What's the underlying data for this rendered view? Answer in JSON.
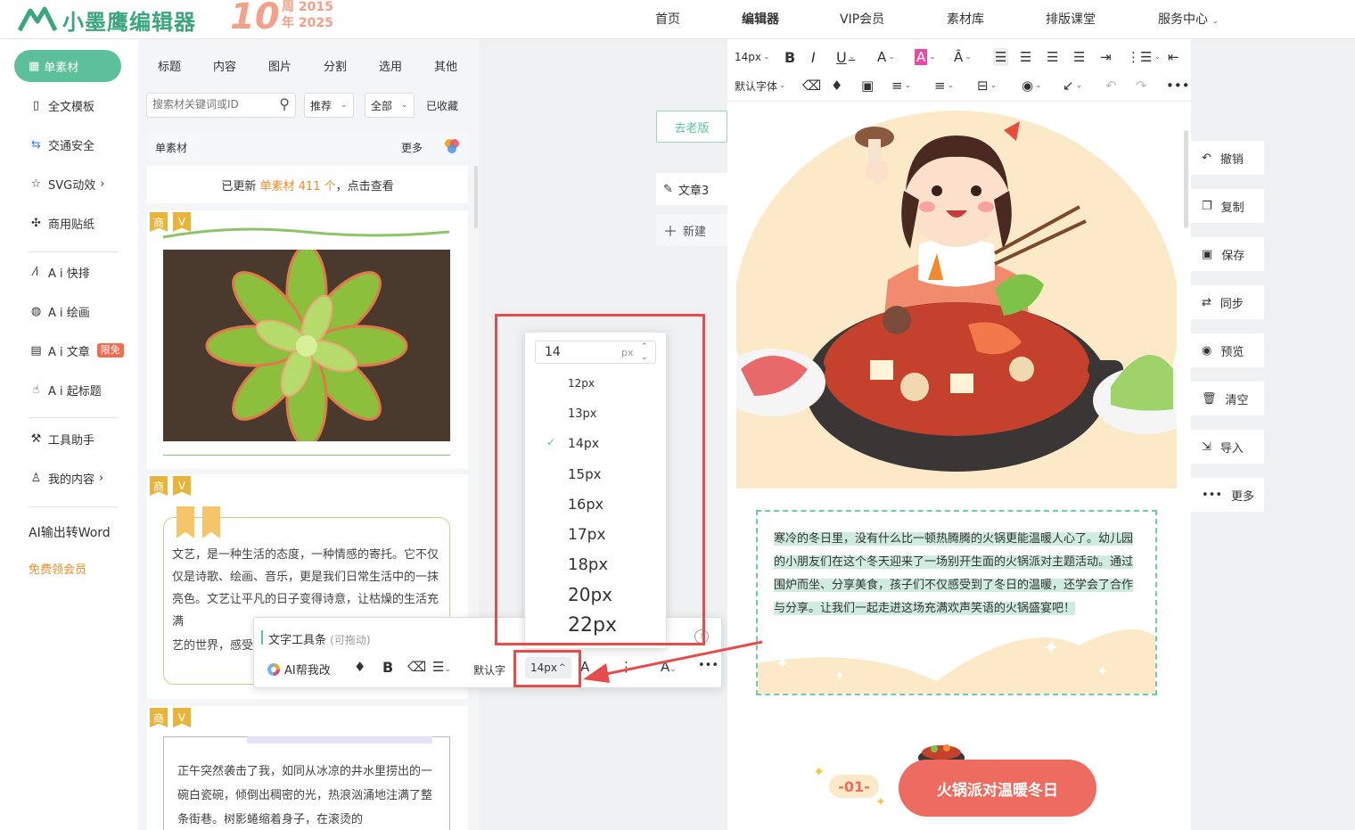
{
  "header": {
    "logo_text": "小墨鹰编辑器",
    "anniv_big": "10",
    "anniv_line1": "周 2015",
    "anniv_line2": "年 2025",
    "nav": [
      "首页",
      "编辑器",
      "VIP会员",
      "素材库",
      "排版课堂",
      "服务中心"
    ]
  },
  "leftnav": {
    "active": "单素材",
    "items": [
      "全文模板",
      "交通安全",
      "SVG动效",
      "商用贴纸",
      "A i 快排",
      "A i 绘画",
      "A i 文章",
      "A i 起标题",
      "工具助手",
      "我的内容"
    ],
    "ai_article_badge": "限免",
    "ai_word": "AI输出转Word",
    "free_vip": "免费领会员"
  },
  "panel": {
    "tabs": [
      "标题",
      "内容",
      "图片",
      "分割",
      "选用",
      "其他"
    ],
    "search_placeholder": "搜索材关键词或ID",
    "dd_recommend": "推荐",
    "dd_all": "全部",
    "collected": "已收藏",
    "head_title": "单素材",
    "head_more": "更多",
    "update_prefix": "已更新",
    "update_highlight": "单素材 411 个",
    "update_suffix": "，点击查看",
    "tag_shang": "商",
    "tag_v": "V",
    "card2_text": "文艺，是一种生活的态度，一种情感的寄托。它不仅仅是诗歌、绘画、音乐，更是我们日常生活中的一抹亮色。文艺让平凡的日子变得诗意，让枯燥的生活充满",
    "card2_tail": "艺的世界，感受",
    "card3_text": "正午突然袭击了我，如同从冰凉的井水里捞出的一碗白瓷碗，倾倒出稠密的光，热浪汹涌地注满了整条街巷。树影蜷缩着身子，在滚烫的"
  },
  "middle": {
    "old_version": "去老版",
    "doc_tab": "文章3",
    "new": "新建"
  },
  "toolbar": {
    "font_size": "14px",
    "default_font": "默认字体"
  },
  "editor": {
    "paragraph": "寒冷的冬日里，没有什么比一顿热腾腾的火锅更能温暖人心了。幼儿园的小朋友们在这个冬天迎来了一场别开生面的火锅派对主题活动。通过围炉而坐、分享美食，孩子们不仅感受到了冬日的温暖，还学会了合作与分享。让我们一起走进这场充满欢声笑语的火锅盛宴吧！",
    "section_num": "-01-",
    "section_title": "火锅派对温暖冬日"
  },
  "right_actions": [
    "撤销",
    "复制",
    "保存",
    "同步",
    "预览",
    "清空",
    "导入",
    "更多"
  ],
  "text_toolbar": {
    "title": "文字工具条",
    "hint": "(可拖动)",
    "ai_btn": "AI帮我改",
    "font": "默认字",
    "size": "14px"
  },
  "fontsize_dropdown": {
    "input_value": "14",
    "unit": "px",
    "options": [
      "12px",
      "13px",
      "14px",
      "15px",
      "16px",
      "17px",
      "18px",
      "20px",
      "22px"
    ],
    "selected": "14px"
  },
  "colors": {
    "brand": "#5cc09a",
    "accent_orange": "#f08a24",
    "annotation_red": "#e74c4c"
  }
}
